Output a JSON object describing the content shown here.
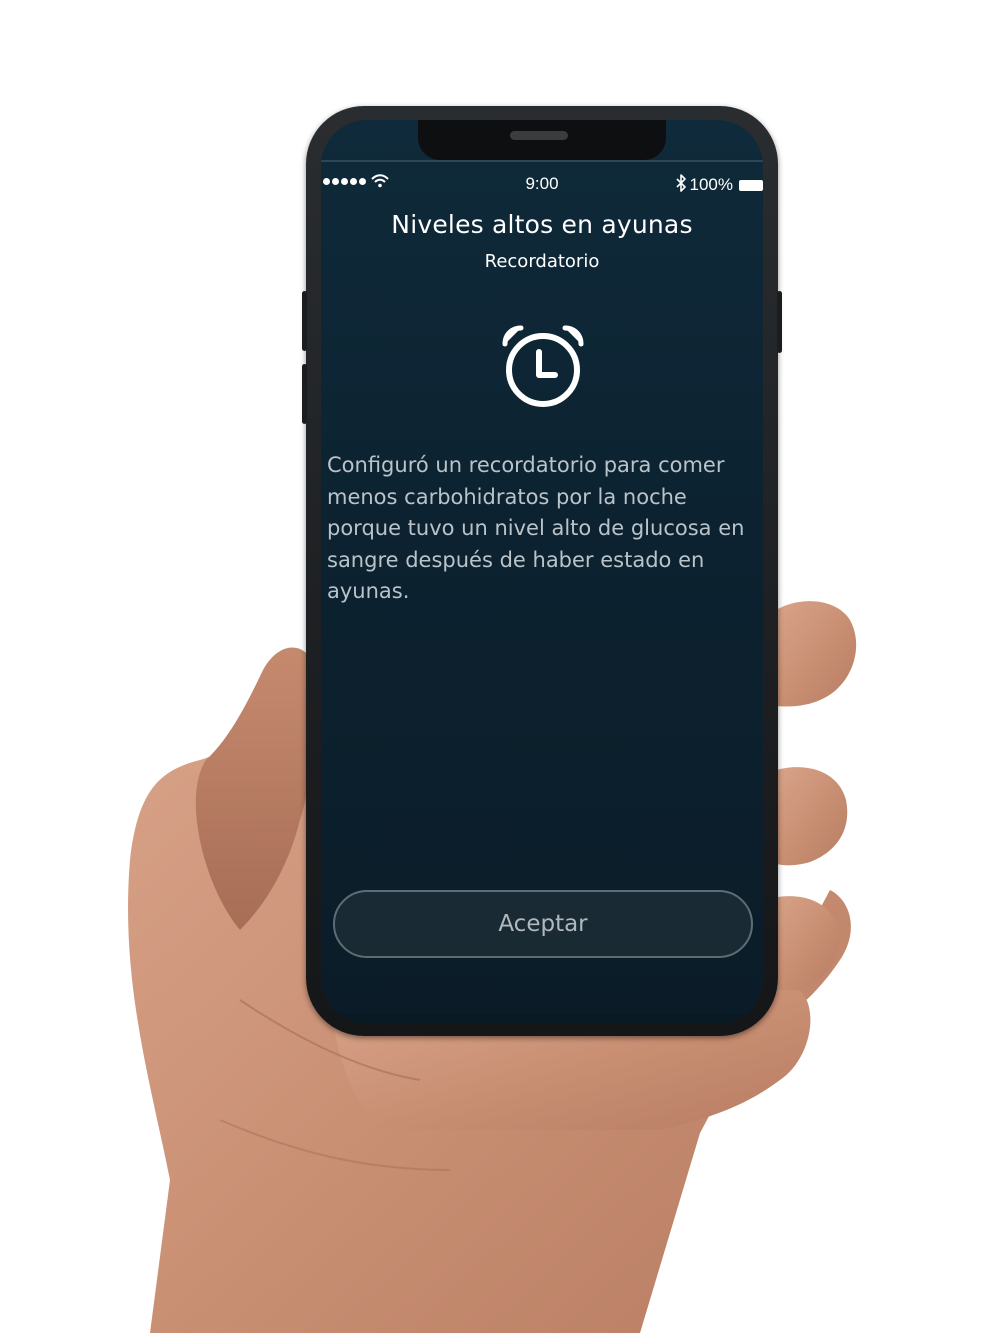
{
  "status_bar": {
    "time": "9:00",
    "battery": "100%",
    "wifi_icon": "wifi-icon",
    "bluetooth_icon": "bluetooth-icon"
  },
  "header": {
    "title": "Niveles altos en ayunas",
    "subtitle": "Recordatorio"
  },
  "icon": "alarm-clock-icon",
  "message": "Configuró un recordatorio para comer menos carbohidratos por la noche porque tuvo un nivel alto de glucosa en sangre después de haber estado en ayunas.",
  "actions": {
    "accept_label": "Aceptar"
  },
  "colors": {
    "screen_background": "#0c2230",
    "text_primary": "#ffffff",
    "text_secondary": "#b9c3c9",
    "button_border": "#5c6d76"
  }
}
